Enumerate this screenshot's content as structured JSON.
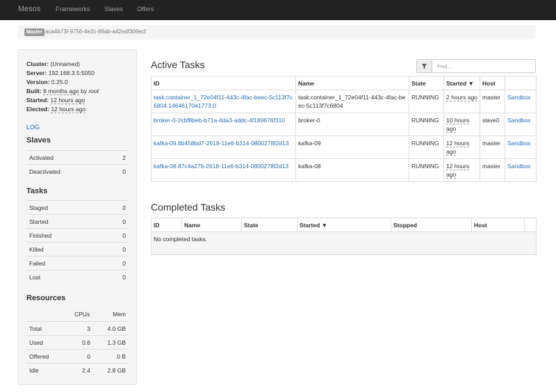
{
  "navbar": {
    "brand": "Mesos",
    "items": [
      "Frameworks",
      "Slaves",
      "Offers"
    ]
  },
  "breadcrumb": {
    "badge": "Master",
    "id": "aca4b73f-9756-4e2c-86ab-a42edf309ecf"
  },
  "sidebar": {
    "cluster_label": "Cluster:",
    "cluster_value": "(Unnamed)",
    "server_label": "Server:",
    "server_value": "192.168.3.5:5050",
    "version_label": "Version:",
    "version_value": "0.25.0",
    "built_label": "Built:",
    "built_time": "8 months ago",
    "built_by_word": "by",
    "built_user": "root",
    "started_label": "Started:",
    "started_value": "12 hours ago",
    "elected_label": "Elected:",
    "elected_value": "12 hours ago",
    "log_link": "LOG",
    "slaves_heading": "Slaves",
    "slaves": [
      {
        "label": "Activated",
        "value": "2"
      },
      {
        "label": "Deactivated",
        "value": "0"
      }
    ],
    "tasks_heading": "Tasks",
    "tasks": [
      {
        "label": "Staged",
        "value": "0"
      },
      {
        "label": "Started",
        "value": "0"
      },
      {
        "label": "Finished",
        "value": "0"
      },
      {
        "label": "Killed",
        "value": "0"
      },
      {
        "label": "Failed",
        "value": "0"
      },
      {
        "label": "Lost",
        "value": "0"
      }
    ],
    "resources_heading": "Resources",
    "resources_cols": [
      "CPUs",
      "Mem"
    ],
    "resources": [
      {
        "label": "Total",
        "cpus": "3",
        "mem": "4.0 GB"
      },
      {
        "label": "Used",
        "cpus": "0.6",
        "mem": "1.3 GB"
      },
      {
        "label": "Offered",
        "cpus": "0",
        "mem": "0 B"
      },
      {
        "label": "Idle",
        "cpus": "2.4",
        "mem": "2.8 GB"
      }
    ]
  },
  "active": {
    "title": "Active Tasks",
    "filter_placeholder": "Find...",
    "filter_icon": "filter-icon",
    "columns": [
      "ID",
      "Name",
      "State",
      "Started ▼",
      "Host",
      ""
    ],
    "rows": [
      {
        "id": "task:container_1_72e04f11-443c-4fac-beec-5c113f7c6804:1464617041773:0",
        "name": "task:container_1_72e04f11-443c-4fac-beec-5c113f7c6804",
        "state": "RUNNING",
        "started": "2 hours ago",
        "host": "master",
        "sandbox": "Sandbox"
      },
      {
        "id": "broker-0-2cbf8beb-b71a-4da3-addc-4f189876f310",
        "name": "broker-0",
        "state": "RUNNING",
        "started": "10 hours ago",
        "host": "slave0",
        "sandbox": "Sandbox"
      },
      {
        "id": "kafka-09.8b458bd7-2618-11e6-b314-0800278f2d13",
        "name": "kafka-09",
        "state": "RUNNING",
        "started": "12 hours ago",
        "host": "master",
        "sandbox": "Sandbox"
      },
      {
        "id": "kafka-08.87c4a276-2618-11e6-b314-0800278f2d13",
        "name": "kafka-08",
        "state": "RUNNING",
        "started": "12 hours ago",
        "host": "master",
        "sandbox": "Sandbox"
      }
    ]
  },
  "completed": {
    "title": "Completed Tasks",
    "columns": [
      "ID",
      "Name",
      "State",
      "Started ▼",
      "Stopped",
      "Host",
      ""
    ],
    "empty_text": "No completed tasks."
  }
}
